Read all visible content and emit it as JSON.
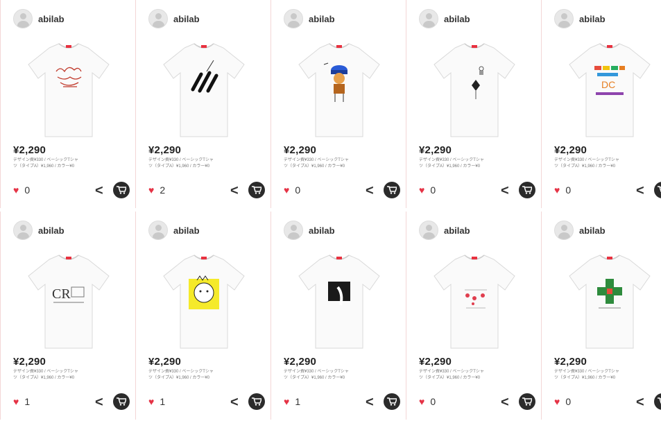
{
  "products": [
    {
      "username": "abilab",
      "price": "¥2,290",
      "desc1": "デザイン費¥330 / ベーシックTシャ",
      "desc2": "ツ（タイプA）¥1,960 / カラー¥0",
      "likes": "0",
      "design": "red-bird"
    },
    {
      "username": "abilab",
      "price": "¥2,290",
      "desc1": "デザイン費¥330 / ベーシックTシャ",
      "desc2": "ツ（タイプA）¥1,960 / カラー¥0",
      "likes": "2",
      "design": "black-strokes"
    },
    {
      "username": "abilab",
      "price": "¥2,290",
      "desc1": "デザイン費¥330 / ベーシックTシャ",
      "desc2": "ツ（タイプA）¥1,960 / カラー¥0",
      "likes": "0",
      "design": "cap-figure"
    },
    {
      "username": "abilab",
      "price": "¥2,290",
      "desc1": "デザイン費¥330 / ベーシックTシャ",
      "desc2": "ツ（タイプA）¥1,960 / カラー¥0",
      "likes": "0",
      "design": "small-figure"
    },
    {
      "username": "abilab",
      "price": "¥2,290",
      "desc1": "デザイン費¥330 / ベーシックTシャ",
      "desc2": "ツ（タイプA）¥1,960 / カラー¥0",
      "likes": "0",
      "design": "color-text"
    },
    {
      "username": "abilab",
      "price": "¥2,290",
      "desc1": "デザイン費¥330 / ベーシックTシャ",
      "desc2": "ツ（タイプA）¥1,960 / カラー¥0",
      "likes": "1",
      "design": "cr-text"
    },
    {
      "username": "abilab",
      "price": "¥2,290",
      "desc1": "デザイン費¥330 / ベーシックTシャ",
      "desc2": "ツ（タイプA）¥1,960 / カラー¥0",
      "likes": "1",
      "design": "yellow-bird"
    },
    {
      "username": "abilab",
      "price": "¥2,290",
      "desc1": "デザイン費¥330 / ベーシックTシャ",
      "desc2": "ツ（タイプA）¥1,960 / カラー¥0",
      "likes": "1",
      "design": "dark-square"
    },
    {
      "username": "abilab",
      "price": "¥2,290",
      "desc1": "デザイン費¥330 / ベーシックTシャ",
      "desc2": "ツ（タイプA）¥1,960 / カラー¥0",
      "likes": "0",
      "design": "red-dots"
    },
    {
      "username": "abilab",
      "price": "¥2,290",
      "desc1": "デザイン費¥330 / ベーシックTシャ",
      "desc2": "ツ（タイプA）¥1,960 / カラー¥0",
      "likes": "0",
      "design": "green-cross"
    }
  ],
  "colors": {
    "heart": "#e53346",
    "cart": "#2b2b2b",
    "border": "#f3d6d6",
    "collar": "#e8313f"
  },
  "icons": {
    "like": "heart-icon",
    "share": "share-icon",
    "cart": "cart-icon"
  }
}
